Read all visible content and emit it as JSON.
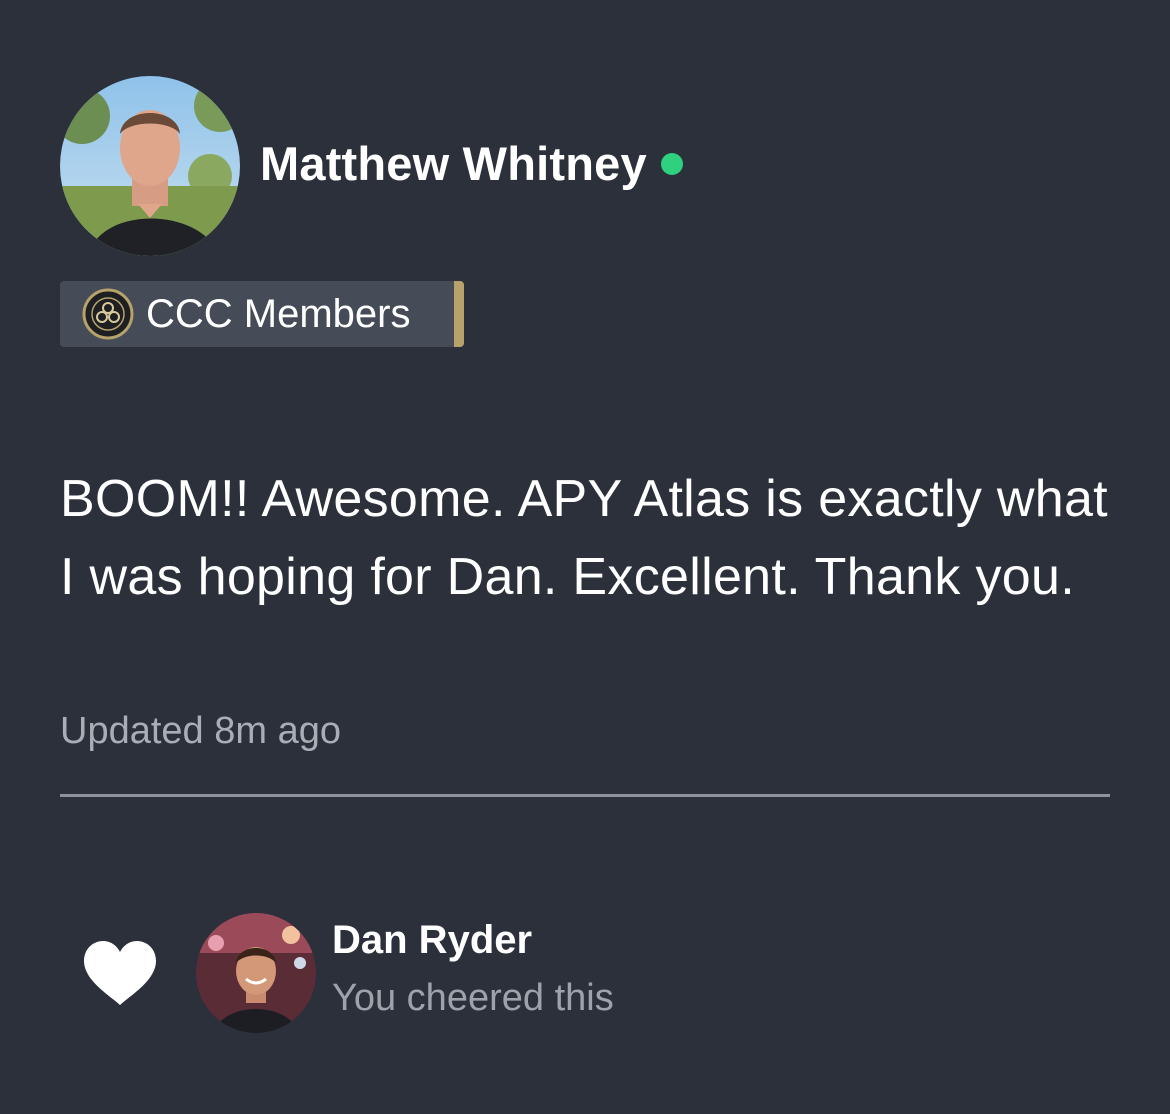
{
  "author": {
    "name": "Matthew Whitney",
    "online": true
  },
  "group": {
    "name": "CCC Members"
  },
  "post": {
    "body": "BOOM!! Awesome. APY Atlas is exactly what I was hoping for Dan. Excellent. Thank you.",
    "updated": "Updated 8m ago"
  },
  "cheer": {
    "name": "Dan Ryder",
    "status": "You cheered this"
  },
  "colors": {
    "background": "#2b303b",
    "online": "#2fd07f",
    "badge_accent": "#b6a26a"
  },
  "icons": {
    "cheer": "heart-icon",
    "group_logo": "ccc-logo-icon"
  }
}
